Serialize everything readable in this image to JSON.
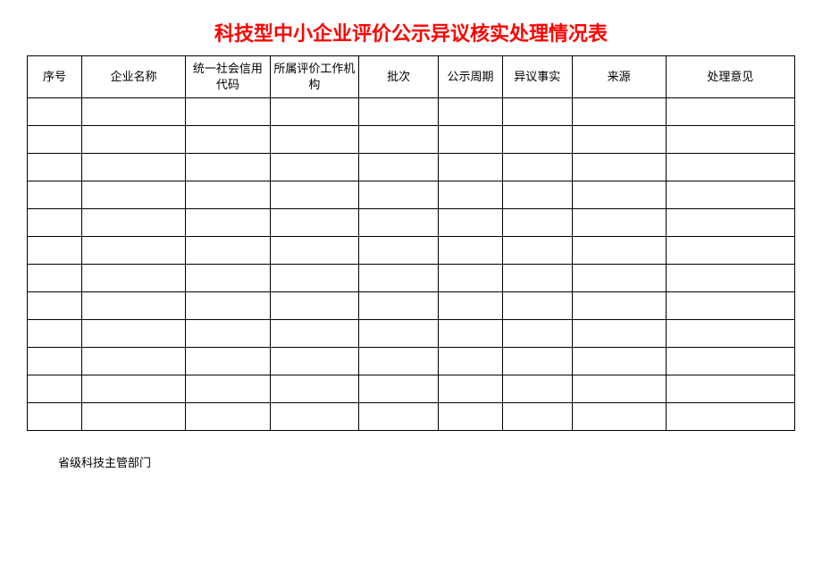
{
  "title": "科技型中小企业评价公示异议核实处理情况表",
  "headers": {
    "seq": "序号",
    "name": "企业名称",
    "code": "统一社会信用代码",
    "org": "所属评价工作机构",
    "batch": "批次",
    "period": "公示周期",
    "fact": "异议事实",
    "source": "来源",
    "opinion": "处理意见"
  },
  "rows": [
    {
      "seq": "",
      "name": "",
      "code": "",
      "org": "",
      "batch": "",
      "period": "",
      "fact": "",
      "source": "",
      "opinion": ""
    },
    {
      "seq": "",
      "name": "",
      "code": "",
      "org": "",
      "batch": "",
      "period": "",
      "fact": "",
      "source": "",
      "opinion": ""
    },
    {
      "seq": "",
      "name": "",
      "code": "",
      "org": "",
      "batch": "",
      "period": "",
      "fact": "",
      "source": "",
      "opinion": ""
    },
    {
      "seq": "",
      "name": "",
      "code": "",
      "org": "",
      "batch": "",
      "period": "",
      "fact": "",
      "source": "",
      "opinion": ""
    },
    {
      "seq": "",
      "name": "",
      "code": "",
      "org": "",
      "batch": "",
      "period": "",
      "fact": "",
      "source": "",
      "opinion": ""
    },
    {
      "seq": "",
      "name": "",
      "code": "",
      "org": "",
      "batch": "",
      "period": "",
      "fact": "",
      "source": "",
      "opinion": ""
    },
    {
      "seq": "",
      "name": "",
      "code": "",
      "org": "",
      "batch": "",
      "period": "",
      "fact": "",
      "source": "",
      "opinion": ""
    },
    {
      "seq": "",
      "name": "",
      "code": "",
      "org": "",
      "batch": "",
      "period": "",
      "fact": "",
      "source": "",
      "opinion": ""
    },
    {
      "seq": "",
      "name": "",
      "code": "",
      "org": "",
      "batch": "",
      "period": "",
      "fact": "",
      "source": "",
      "opinion": ""
    },
    {
      "seq": "",
      "name": "",
      "code": "",
      "org": "",
      "batch": "",
      "period": "",
      "fact": "",
      "source": "",
      "opinion": ""
    },
    {
      "seq": "",
      "name": "",
      "code": "",
      "org": "",
      "batch": "",
      "period": "",
      "fact": "",
      "source": "",
      "opinion": ""
    },
    {
      "seq": "",
      "name": "",
      "code": "",
      "org": "",
      "batch": "",
      "period": "",
      "fact": "",
      "source": "",
      "opinion": ""
    }
  ],
  "footer": {
    "label": "省级科技主管部门"
  }
}
